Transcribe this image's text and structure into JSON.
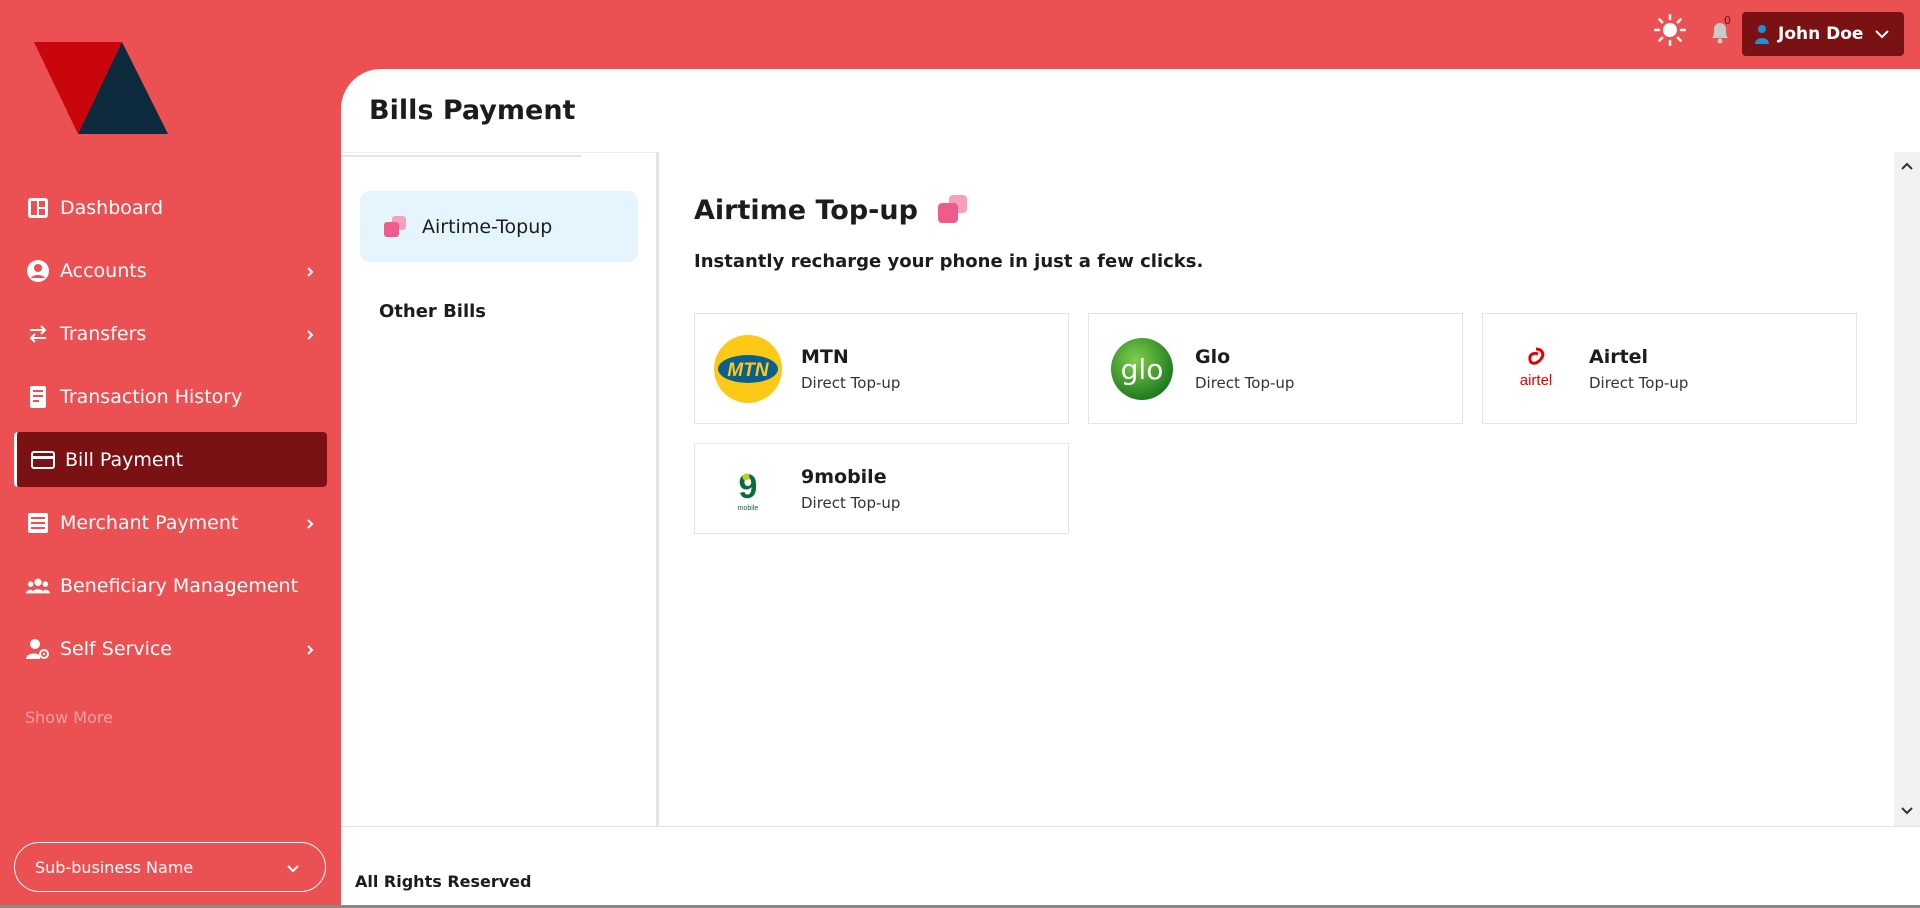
{
  "sidebar": {
    "items": [
      {
        "label": "Dashboard",
        "icon": "dashboard-icon"
      },
      {
        "label": "Accounts",
        "icon": "account-circle-icon"
      },
      {
        "label": "Transfers",
        "icon": "transfer-arrows-icon"
      },
      {
        "label": "Transaction History",
        "icon": "receipt-icon"
      },
      {
        "label": "Bill Payment",
        "icon": "credit-card-icon"
      },
      {
        "label": "Merchant Payment",
        "icon": "list-doc-icon"
      },
      {
        "label": "Beneficiary Management",
        "icon": "group-icon"
      },
      {
        "label": "Self Service",
        "icon": "user-settings-icon"
      }
    ],
    "show_more": "Show More",
    "sub_business": "Sub-business Name"
  },
  "topbar": {
    "user_name": "John Doe",
    "notification_count": "0"
  },
  "main": {
    "page_title": "Bills Payment",
    "tabs": [
      "Airtime-Topup",
      "Other Bills"
    ],
    "section_title": "Airtime Top-up",
    "section_subtitle": "Instantly recharge your phone in just a few clicks.",
    "providers": [
      {
        "name": "MTN",
        "desc": "Direct Top-up",
        "logo_text": "MTN"
      },
      {
        "name": "Glo",
        "desc": "Direct Top-up",
        "logo_text": "glo"
      },
      {
        "name": "Airtel",
        "desc": "Direct Top-up",
        "logo_text": "airtel"
      },
      {
        "name": "9mobile",
        "desc": "Direct Top-up",
        "logo_text": "9",
        "logo_sub": "mobile"
      }
    ],
    "footer": "All Rights Reserved"
  },
  "colors": {
    "brand_red": "#eb5052",
    "active_dark_red": "#7a1214",
    "tab_highlight": "#e4f5fd"
  }
}
